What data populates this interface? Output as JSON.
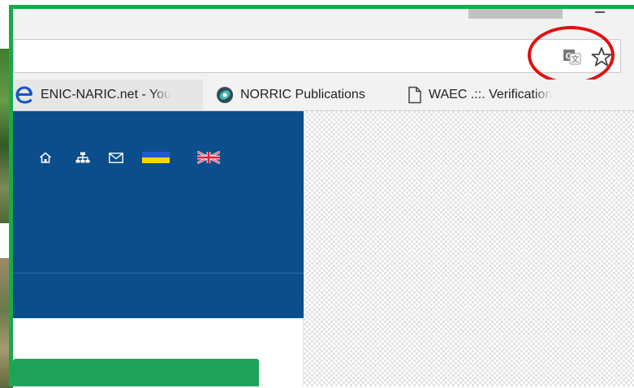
{
  "window": {
    "profile_button": "",
    "minimize": ""
  },
  "omnibox": {
    "url": "",
    "translate_icon": "google-translate-icon",
    "bookmark_star_icon": "star-outline-icon",
    "highlight_color": "#e01010"
  },
  "bookmarks": [
    {
      "label": "ENIC-NARIC.net - You",
      "icon": "enic-naric-e-icon"
    },
    {
      "label": "NORRIC Publications",
      "icon": "norric-eye-icon"
    },
    {
      "label": "WAEC .::. Verification",
      "icon": "page-icon"
    }
  ],
  "site": {
    "header_color": "#0b4e8b",
    "accent_green": "#1fa35a",
    "frame_green": "#19a84a",
    "nav_icons": [
      "home-icon",
      "sitemap-icon",
      "mail-icon",
      "ukraine-flag-icon",
      "uk-flag-icon"
    ]
  }
}
